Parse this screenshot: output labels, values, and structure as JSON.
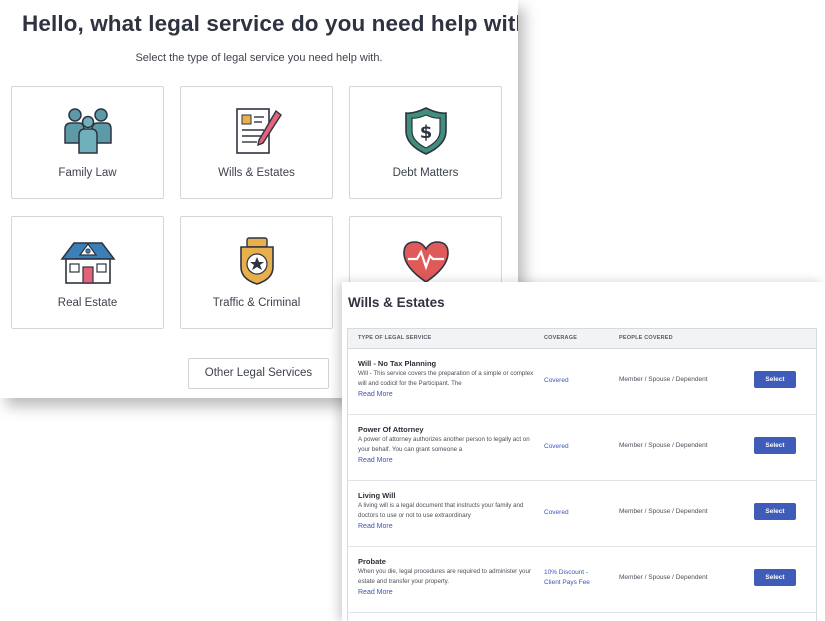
{
  "services_panel": {
    "heading": "Hello, what legal service do you need help with today?",
    "subtitle": "Select the type of legal service you need help with.",
    "cards": [
      {
        "label": "Family Law",
        "icon": "family-icon"
      },
      {
        "label": "Wills & Estates",
        "icon": "document-pen-icon"
      },
      {
        "label": "Debt Matters",
        "icon": "dollar-shield-icon"
      },
      {
        "label": "Real Estate",
        "icon": "house-icon"
      },
      {
        "label": "Traffic & Criminal",
        "icon": "police-badge-icon"
      },
      {
        "label": "",
        "icon": "heart-pulse-icon"
      }
    ],
    "other_button": "Other Legal Services"
  },
  "wills_panel": {
    "title": "Wills & Estates",
    "columns": [
      "TYPE OF LEGAL SERVICE",
      "COVERAGE",
      "PEOPLE COVERED"
    ],
    "rows": [
      {
        "name": "Will - No Tax Planning",
        "description": "Will - This service covers the preparation of a simple or complex will and codicil for the Participant. The",
        "read_more": "Read More",
        "coverage_line1": "Covered",
        "coverage_line2": "",
        "people": "Member / Spouse / Dependent",
        "button": "Select"
      },
      {
        "name": "Power Of Attorney",
        "description": "A power of attorney authorizes another person to legally act on your behalf. You can grant someone a",
        "read_more": "Read More",
        "coverage_line1": "Covered",
        "coverage_line2": "",
        "people": "Member / Spouse / Dependent",
        "button": "Select"
      },
      {
        "name": "Living Will",
        "description": "A living will is a legal document that instructs your family and doctors to use or not to use extraordinary",
        "read_more": "Read More",
        "coverage_line1": "Covered",
        "coverage_line2": "",
        "people": "Member / Spouse / Dependent",
        "button": "Select"
      },
      {
        "name": "Probate",
        "description": "When you die, legal procedures are required to administer your estate and transfer your property.",
        "read_more": "Read More",
        "coverage_line1": "10% Discount -",
        "coverage_line2": "Client Pays Fee",
        "people": "Member / Spouse / Dependent",
        "button": "Select"
      }
    ]
  },
  "colors": {
    "accent_blue": "#3e5cb8",
    "link_blue": "#3b57b8",
    "icon_teal": "#5b9aa6",
    "icon_green": "#3f8f7c",
    "icon_red": "#e05a5a",
    "icon_gold": "#e8b04c"
  }
}
